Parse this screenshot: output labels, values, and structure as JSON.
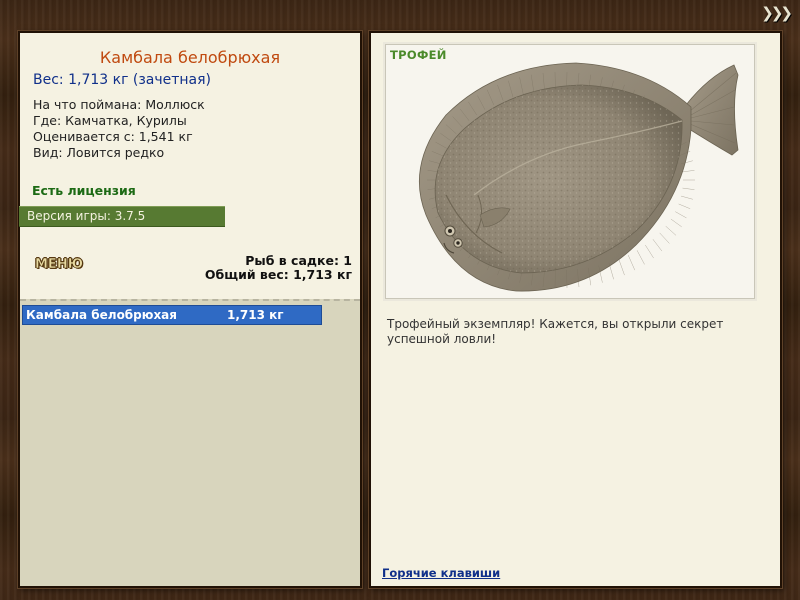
{
  "nav": {
    "arrows": "❯❯❯"
  },
  "fish": {
    "title": "Камбала белобрюхая",
    "weight_line": "Вес: 1,713 кг (зачетная)",
    "bait_line": "На что поймана: Моллюск",
    "location_line": "Где: Камчатка, Курилы",
    "valued_line": "Оценивается с: 1,541 кг",
    "rarity_line": "Вид: Ловится редко"
  },
  "license_text": "Есть лицензия",
  "version_text": "Версия игры: 3.7.5",
  "menu_label": "МЕНЮ",
  "stats": {
    "fish_count_line": "Рыб в садке: 1",
    "total_weight_line": "Общий вес: 1,713 кг"
  },
  "catch_list": [
    {
      "name": "Камбала белобрюхая",
      "weight": "1,713 кг"
    }
  ],
  "trophy": {
    "label": "ТРОФЕЙ",
    "description": "Трофейный экземпляр! Кажется, вы открыли секрет успешной ловли!"
  },
  "hotkeys_link": "Горячие клавиши",
  "icons": {
    "nav": "triple-chevron-right-icon"
  },
  "colors": {
    "title": "#c04a10",
    "weight": "#10308a",
    "license": "#1c6a14",
    "version_bar": "#577a32",
    "selected_row": "#2f6ac4",
    "trophy_label": "#4b8a2a",
    "link": "#10308a"
  }
}
